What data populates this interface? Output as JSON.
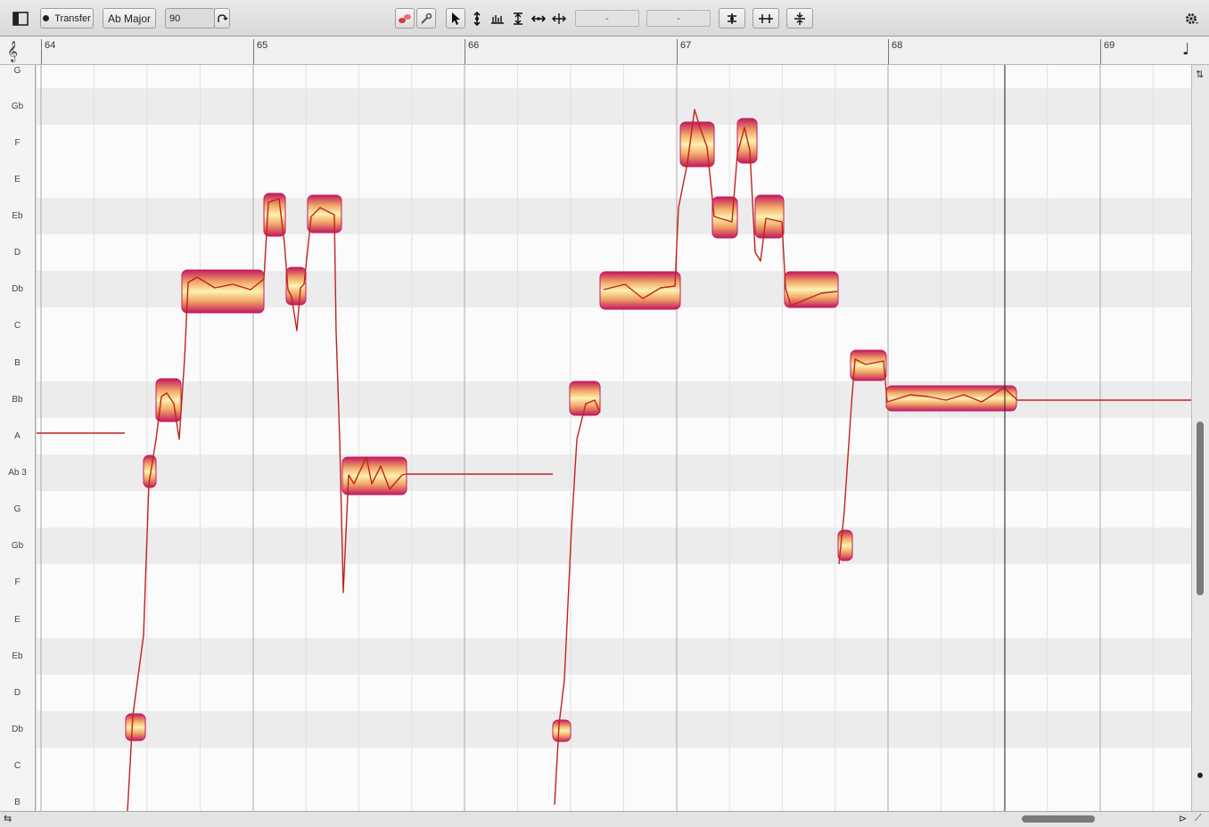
{
  "toolbar": {
    "panel_toggle_icon": "sidebar-panel-icon",
    "transfer_label": "Transfer",
    "key_label": "Ab Major",
    "tempo_value": "90",
    "field_one": "-",
    "field_two": "-",
    "settings_icon": "gear-icon"
  },
  "ruler": {
    "bars": [
      "64",
      "65",
      "66",
      "67",
      "68",
      "69"
    ]
  },
  "pitch_labels": [
    "G",
    "Gb",
    "F",
    "E",
    "Eb",
    "D",
    "Db",
    "C",
    "B",
    "Bb",
    "A",
    "Ab 3",
    "G",
    "Gb",
    "F",
    "E",
    "Eb",
    "D",
    "Db",
    "C",
    "B"
  ],
  "colors": {
    "blob_outer": "#c4195e",
    "blob_inner": "#ffe9a0",
    "pitch_curve": "#c0231c",
    "playhead": "#1a1a1a",
    "lane_dark": "#ececec",
    "lane_light": "#fbfbfb"
  }
}
